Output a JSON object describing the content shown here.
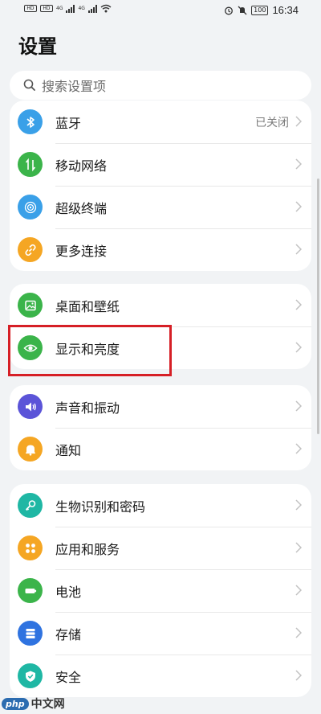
{
  "status_bar": {
    "sim1": "HD",
    "sim2": "HD",
    "net1": "4G",
    "net2": "4G",
    "battery": "100",
    "time": "16:34"
  },
  "page_title": "设置",
  "search": {
    "placeholder": "搜索设置项",
    "icon": "search-icon"
  },
  "groups": [
    {
      "items": [
        {
          "label": "蓝牙",
          "value": "已关闭",
          "icon": "bluetooth-icon",
          "color": "#3aa0e8"
        },
        {
          "label": "移动网络",
          "value": "",
          "icon": "mobile-network-icon",
          "color": "#3bb44a"
        },
        {
          "label": "超级终端",
          "value": "",
          "icon": "super-device-icon",
          "color": "#3aa0e8"
        },
        {
          "label": "更多连接",
          "value": "",
          "icon": "link-icon",
          "color": "#f5a623"
        }
      ]
    },
    {
      "items": [
        {
          "label": "桌面和壁纸",
          "value": "",
          "icon": "wallpaper-icon",
          "color": "#3bb44a"
        },
        {
          "label": "显示和亮度",
          "value": "",
          "icon": "eye-icon",
          "color": "#3bb44a"
        }
      ]
    },
    {
      "items": [
        {
          "label": "声音和振动",
          "value": "",
          "icon": "sound-icon",
          "color": "#5b54d8"
        },
        {
          "label": "通知",
          "value": "",
          "icon": "bell-icon",
          "color": "#f5a623"
        }
      ]
    },
    {
      "items": [
        {
          "label": "生物识别和密码",
          "value": "",
          "icon": "key-icon",
          "color": "#1fb7a4"
        },
        {
          "label": "应用和服务",
          "value": "",
          "icon": "apps-icon",
          "color": "#f5a623"
        },
        {
          "label": "电池",
          "value": "",
          "icon": "battery-icon",
          "color": "#3bb44a"
        },
        {
          "label": "存储",
          "value": "",
          "icon": "storage-icon",
          "color": "#2f73e0"
        },
        {
          "label": "安全",
          "value": "",
          "icon": "shield-icon",
          "color": "#1fb7a4"
        }
      ]
    }
  ],
  "watermark": {
    "badge": "php",
    "text": "中文网"
  }
}
